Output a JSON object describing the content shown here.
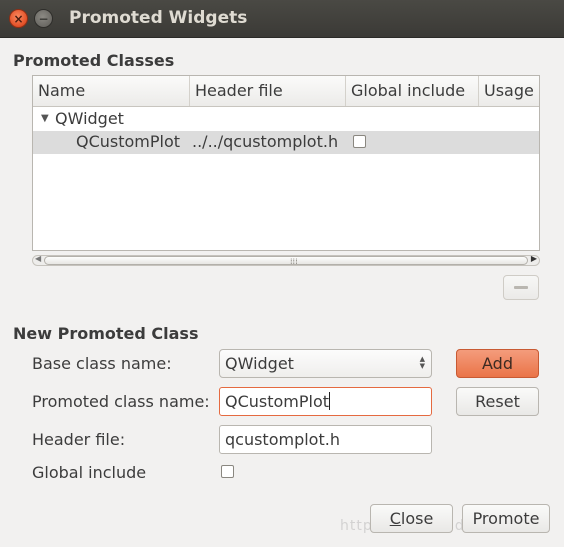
{
  "window": {
    "title": "Promoted Widgets",
    "close_glyph": "×",
    "minimize_glyph": "−"
  },
  "promoted_classes": {
    "section_title": "Promoted Classes",
    "columns": [
      "Name",
      "Header file",
      "Global include",
      "Usage"
    ],
    "groups": [
      {
        "base_class": "QWidget",
        "expanded": true,
        "expander_glyph": "▼",
        "rows": [
          {
            "name": "QCustomPlot",
            "header_file": "../../qcustomplot.h",
            "global_include": false,
            "selected": true
          }
        ]
      }
    ],
    "scrollbar": {
      "left_arrow": "◀",
      "right_arrow": "▶",
      "grip": "⁞⁞⁞"
    },
    "remove_button_icon": "minus-icon"
  },
  "new_promoted_class": {
    "section_title": "New Promoted Class",
    "base_class_label": "Base class name:",
    "base_class_value": "QWidget",
    "combo_up": "▲",
    "combo_down": "▼",
    "promoted_class_label": "Promoted class name:",
    "promoted_class_value": "QCustomPlot",
    "header_file_label": "Header file:",
    "header_file_value": "qcustomplot.h",
    "global_include_label": "Global include",
    "global_include_checked": false,
    "add_label": "Add",
    "reset_label": "Reset"
  },
  "footer": {
    "close_label": "Close",
    "promote_label": "Promote",
    "watermark": "https://blog.csdn.net/"
  },
  "colors": {
    "titlebar": "#3b3a36",
    "accent": "#ea7448",
    "focus_border": "#e56a40",
    "selected_row": "#dcdcdc"
  }
}
